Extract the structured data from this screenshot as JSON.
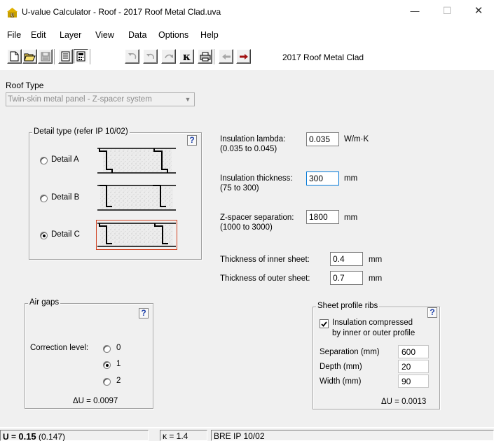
{
  "window": {
    "title": "U-value Calculator - Roof - 2017 Roof Metal Clad.uva",
    "minimize_glyph": "—",
    "maximize_glyph": "☐",
    "close_glyph": "✕"
  },
  "menu": [
    "File",
    "Edit",
    "Layer",
    "View",
    "Data",
    "Options",
    "Help"
  ],
  "toolbar": {
    "icons": [
      "new-file-icon",
      "open-folder-icon",
      "save-disk-icon",
      "report-icon",
      "calculator-icon",
      "undo-icon",
      "undo-step-icon",
      "redo-icon",
      "kappa-icon",
      "print-icon",
      "back-arrow-icon",
      "forward-arrow-icon"
    ],
    "kappa_label": "κ",
    "filename": "2017 Roof Metal Clad"
  },
  "roof_type": {
    "label": "Roof Type",
    "selected": "Twin-skin metal panel - Z-spacer system"
  },
  "detail_type": {
    "title": "Detail type (refer IP 10/02)",
    "help": "?",
    "options": [
      {
        "label": "Detail A",
        "selected": false
      },
      {
        "label": "Detail B",
        "selected": false
      },
      {
        "label": "Detail C",
        "selected": true
      }
    ]
  },
  "insulation": {
    "lambda_label": "Insulation lambda:",
    "lambda_value": "0.035",
    "lambda_unit": "W/m·K",
    "lambda_range": "(0.035 to 0.045)",
    "thickness_label": "Insulation thickness:",
    "thickness_value": "300",
    "thickness_unit": "mm",
    "thickness_range": "(75 to 300)",
    "spacer_label": "Z-spacer separation:",
    "spacer_value": "1800",
    "spacer_unit": "mm",
    "spacer_range": "(1000 to 3000)",
    "inner_label": "Thickness of inner sheet:",
    "inner_value": "0.4",
    "inner_unit": "mm",
    "outer_label": "Thickness of outer sheet:",
    "outer_value": "0.7",
    "outer_unit": "mm"
  },
  "air_gaps": {
    "title": "Air gaps",
    "help": "?",
    "correction_label": "Correction level:",
    "levels": [
      {
        "label": "0",
        "selected": false
      },
      {
        "label": "1",
        "selected": true
      },
      {
        "label": "2",
        "selected": false
      }
    ],
    "delta_u": "ΔU = 0.0097"
  },
  "sheet_profile": {
    "title": "Sheet profile ribs",
    "help": "?",
    "checkbox_label_1": "Insulation compressed",
    "checkbox_label_2": "by inner or outer profile",
    "checked": true,
    "separation_label": "Separation (mm)",
    "separation_value": "600",
    "depth_label": "Depth (mm)",
    "depth_value": "20",
    "width_label": "Width (mm)",
    "width_value": "90",
    "delta_u": "ΔU = 0.0013"
  },
  "status": {
    "u_prefix": "U = ",
    "u_value": "0.15",
    "u_precise": "(0.147)",
    "kappa": "κ = 1.4",
    "reference": "BRE IP 10/02"
  },
  "colors": {
    "selection_border": "#d04020",
    "focus_border": "#0078d7",
    "forward_arrow": "#a01010",
    "help_blue": "#2244aa"
  }
}
